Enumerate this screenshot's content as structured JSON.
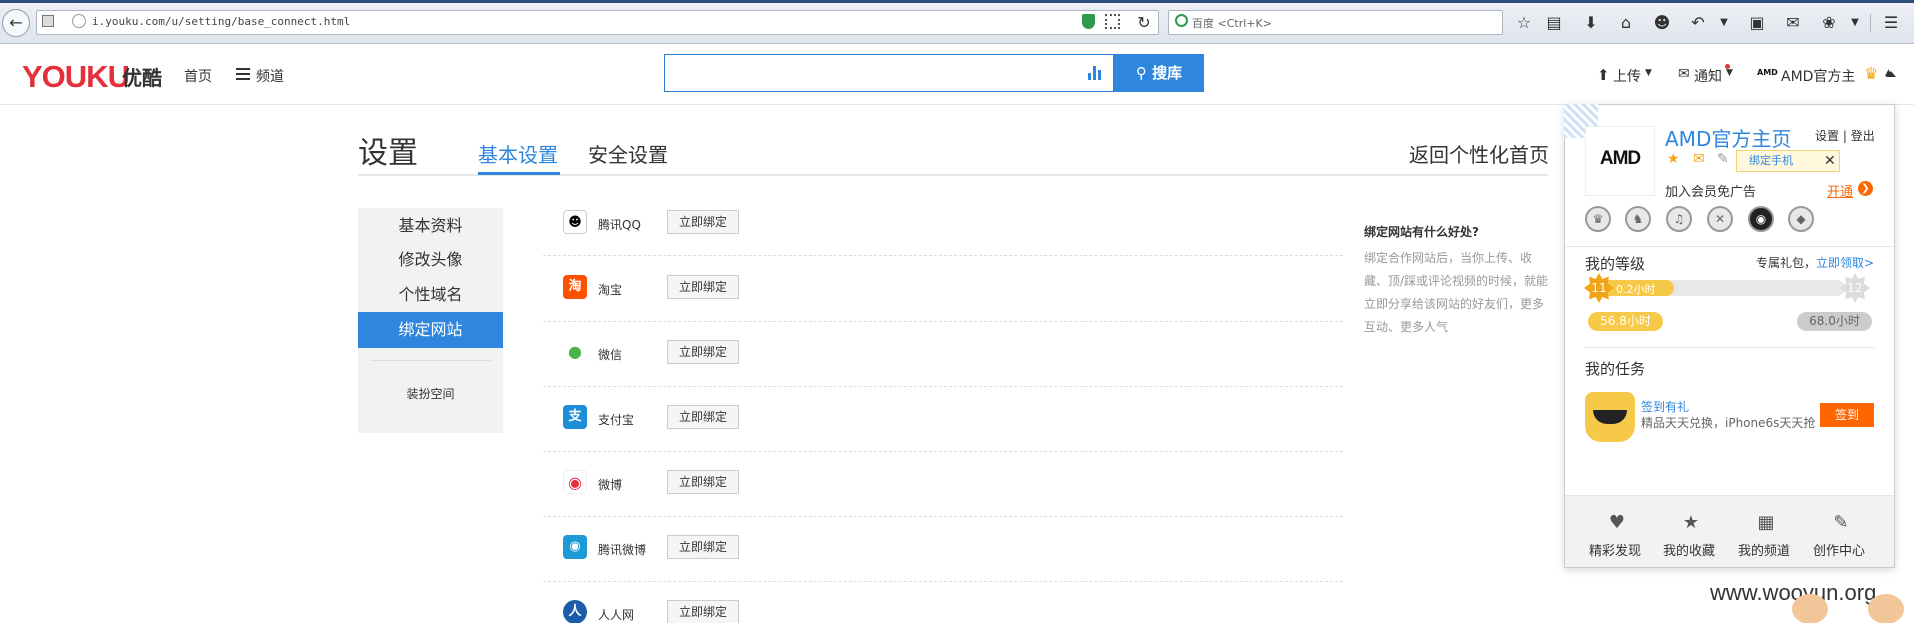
{
  "browser": {
    "url": "i.youku.com/u/setting/base_connect.html",
    "search_placeholder": "百度 <Ctrl+K>"
  },
  "header": {
    "logo": "YOUKU",
    "logo_cn": "优酷",
    "nav": [
      "首页",
      "频道"
    ],
    "search_button": "搜库",
    "upload": "上传",
    "notify": "通知",
    "user": "AMD官方主"
  },
  "settings": {
    "title": "设置",
    "tabs": [
      "基本设置",
      "安全设置"
    ],
    "return_link": "返回个性化首页",
    "sidebar": [
      "基本资料",
      "修改头像",
      "个性域名",
      "绑定网站",
      "装扮空间"
    ],
    "bind_button": "立即绑定",
    "sites": [
      {
        "name": "腾讯QQ",
        "icon": "qq-icon",
        "color": "#ffffff"
      },
      {
        "name": "淘宝",
        "icon": "taobao-icon",
        "color": "#ff5000"
      },
      {
        "name": "微信",
        "icon": "wechat-icon",
        "color": "#ffffff"
      },
      {
        "name": "支付宝",
        "icon": "alipay-icon",
        "color": "#1a8fd8"
      },
      {
        "name": "微博",
        "icon": "weibo-icon",
        "color": "#ffffff"
      },
      {
        "name": "腾讯微博",
        "icon": "tencent-weibo-icon",
        "color": "#1d9ad6"
      },
      {
        "name": "人人网",
        "icon": "renren-icon",
        "color": "#1c5ca8"
      }
    ],
    "benefit_title": "绑定网站有什么好处?",
    "benefit_text": "绑定合作网站后，当你上传、收藏、顶/踩或评论视频的时候，就能立即分享给该网站的好友们，更多互动、更多人气"
  },
  "popup": {
    "avatar_text": "AMD",
    "name": "AMD官方主页",
    "settings_link": "设置",
    "logout_link": "登出",
    "bind_phone": "绑定手机",
    "vip_text": "加入会员免广告",
    "vip_open": "开通",
    "level_title": "我的等级",
    "gift_text": "专属礼包，",
    "gift_link": "立即领取>",
    "current_level": "11",
    "next_level": "12",
    "level_progress": 0.3,
    "bar_text": "0.2小时",
    "hours_left": "56.8小时",
    "hours_right": "68.0小时",
    "task_title": "我的任务",
    "task_name": "签到有礼",
    "task_desc": "精品天天兑换，iPhone6s天天抢",
    "sign_button": "签到",
    "bottom": [
      "精彩发现",
      "我的收藏",
      "我的频道",
      "创作中心"
    ]
  },
  "watermark": "www.wooyun.org"
}
